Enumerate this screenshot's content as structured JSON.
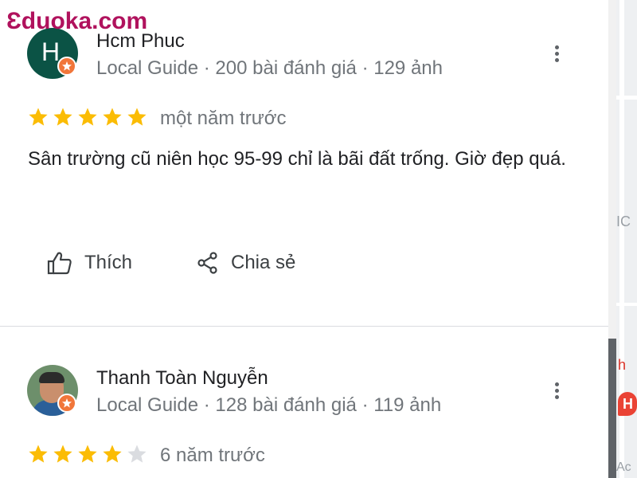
{
  "watermark": {
    "text": "Ɛduoka.com"
  },
  "reviews": [
    {
      "avatar_letter": "H",
      "name": "Hcm Phuc",
      "meta": "Local Guide · 200 bài đánh giá · 129 ảnh",
      "rating": 5,
      "date": "một năm trước",
      "text": "Sân trường cũ niên học 95-99  chỉ là bãi đất trống. Giờ đẹp quá.",
      "actions": {
        "like_label": "Thích",
        "share_label": "Chia sẻ"
      }
    },
    {
      "name": "Thanh Toàn Nguyễn",
      "meta": "Local Guide · 128 bài đánh giá · 119 ảnh",
      "rating": 4,
      "date": "6 năm trước"
    }
  ],
  "map_edge": {
    "labels": [
      "IC",
      "h",
      "H",
      "Ac"
    ]
  },
  "icons": {
    "more": "more-vert-icon",
    "like": "thumb-up-icon",
    "share": "share-icon",
    "badge": "local-guide-badge-icon",
    "star_filled": "star-filled-icon",
    "star_empty": "star-empty-icon"
  },
  "colors": {
    "star_filled": "#fbbc04",
    "star_empty": "#dadce0",
    "badge": "#f1763a",
    "watermark": "#b0125d",
    "secondary_text": "#70757a"
  }
}
